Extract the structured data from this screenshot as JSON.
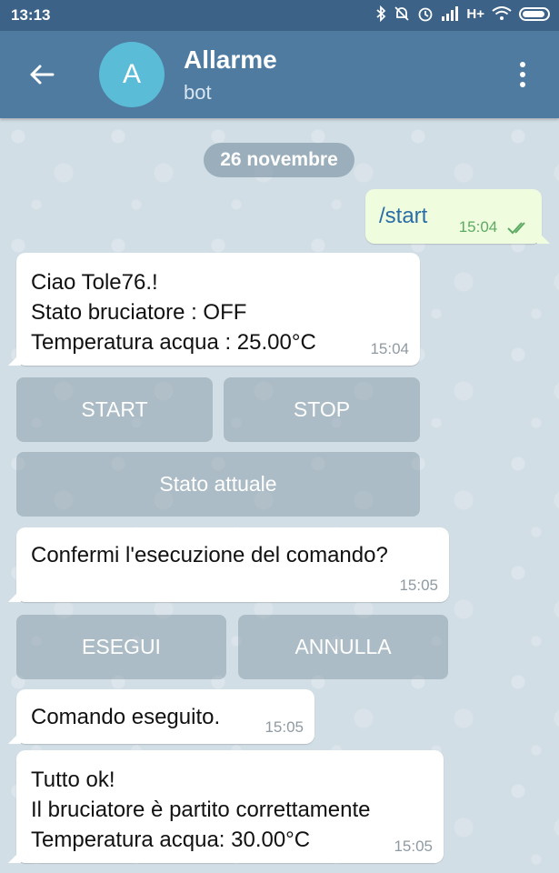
{
  "status_bar": {
    "time": "13:13",
    "network": "H+",
    "icons": [
      "bluetooth-icon",
      "mute-icon",
      "alarm-icon",
      "signal-icon",
      "wifi-icon",
      "battery-icon"
    ]
  },
  "header": {
    "avatar_letter": "A",
    "title": "Allarme",
    "subtitle": "bot",
    "accent": "#4f7ba1",
    "avatar_color": "#5bbcd7"
  },
  "date_separator": "26 novembre",
  "messages": {
    "m1": {
      "text": "/start",
      "time": "15:04",
      "outgoing": true
    },
    "m2": {
      "lines": [
        "Ciao Tole76.!",
        "Stato bruciatore : OFF",
        "Temperatura acqua : 25.00°C"
      ],
      "time": "15:04"
    },
    "m3": {
      "text": "Confermi l'esecuzione del comando?",
      "time": "15:05"
    },
    "m4": {
      "text": "Comando eseguito.",
      "time": "15:05"
    },
    "m5": {
      "lines": [
        "Tutto ok!",
        "Il bruciatore è partito correttamente",
        "Temperatura acqua: 30.00°C"
      ],
      "time": "15:05"
    }
  },
  "keyboards": {
    "k1": {
      "start": "START",
      "stop": "STOP",
      "stato": "Stato attuale"
    },
    "k2": {
      "esegui": "ESEGUI",
      "annulla": "ANNULLA"
    }
  }
}
